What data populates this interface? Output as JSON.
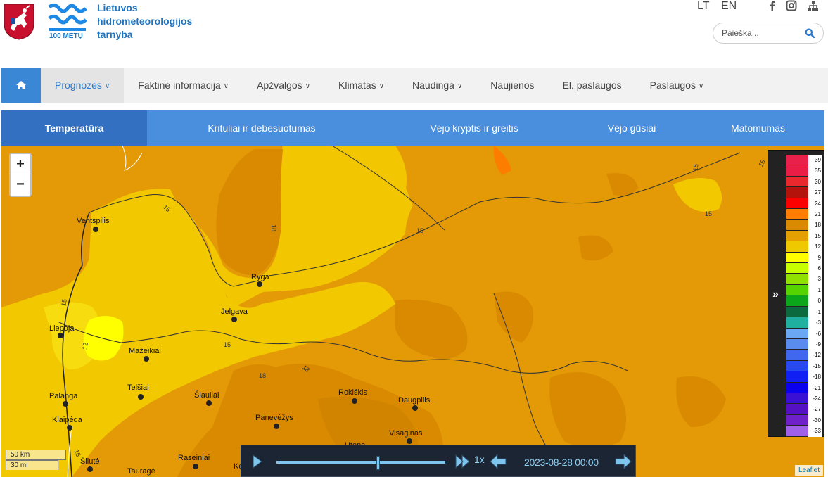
{
  "header": {
    "org_name_lines": [
      "Lietuvos",
      "hidrometeorologijos",
      "tarnyba"
    ],
    "logo_badge": "100 METŲ",
    "lang_lt": "LT",
    "lang_en": "EN",
    "search_placeholder": "Paieška...",
    "social_icons": [
      "facebook-icon",
      "instagram-icon",
      "sitemap-icon"
    ]
  },
  "nav": {
    "items": [
      {
        "label": "Prognozės",
        "dropdown": true,
        "active": true
      },
      {
        "label": "Faktinė informacija",
        "dropdown": true
      },
      {
        "label": "Apžvalgos",
        "dropdown": true
      },
      {
        "label": "Klimatas",
        "dropdown": true
      },
      {
        "label": "Naudinga",
        "dropdown": true
      },
      {
        "label": "Naujienos",
        "dropdown": false
      },
      {
        "label": "El. paslaugos",
        "dropdown": false
      },
      {
        "label": "Paslaugos",
        "dropdown": true
      }
    ]
  },
  "subnav": {
    "items": [
      {
        "label": "Temperatūra",
        "active": true
      },
      {
        "label": "Krituliai ir debesuotumas"
      },
      {
        "label": "Vėjo kryptis ir greitis"
      },
      {
        "label": "Vėjo gūsiai"
      },
      {
        "label": "Matomumas"
      }
    ]
  },
  "map": {
    "zoom_in": "+",
    "zoom_out": "−",
    "cities": [
      "Ventspilis",
      "Ryga",
      "Jelgava",
      "Liepoja",
      "Mažeikiai",
      "Telšiai",
      "Šiauliai",
      "Rokiškis",
      "Daugpilis",
      "Palanga",
      "Klaipėda",
      "Panevėžys",
      "Visaginas",
      "Utena",
      "Šilutė",
      "Raseiniai",
      "Tauragė",
      "Ke"
    ],
    "isoline_labels": [
      "15",
      "18",
      "15",
      "15",
      "15",
      "12",
      "15",
      "18",
      "18",
      "15",
      "15",
      "15"
    ],
    "scale_km": "50 km",
    "scale_mi": "30 mi",
    "attribution": "Leaflet"
  },
  "legend": {
    "values": [
      "39",
      "35",
      "30",
      "27",
      "24",
      "21",
      "18",
      "15",
      "12",
      "9",
      "6",
      "3",
      "1",
      "0",
      "-1",
      "-3",
      "-6",
      "-9",
      "-12",
      "-15",
      "-18",
      "-21",
      "-24",
      "-27",
      "-30",
      "-33"
    ],
    "colors": [
      "#e8204a",
      "#e91d45",
      "#e8282c",
      "#b3130a",
      "#fc0000",
      "#fc7d00",
      "#d98a00",
      "#e3a000",
      "#f0c800",
      "#ffff00",
      "#c8ff00",
      "#90e000",
      "#56d400",
      "#0ba61a",
      "#0b6b3e",
      "#20b0a0",
      "#6aa8f4",
      "#5a8cf0",
      "#4068ee",
      "#2848f0",
      "#1020f5",
      "#0a00ee",
      "#3a10d4",
      "#5610c4",
      "#7020c8",
      "#a060e8"
    ],
    "toggle_glyph": "»"
  },
  "player": {
    "speed": "1x",
    "timestamp": "2023-08-28 00:00",
    "progress": 0.605
  }
}
